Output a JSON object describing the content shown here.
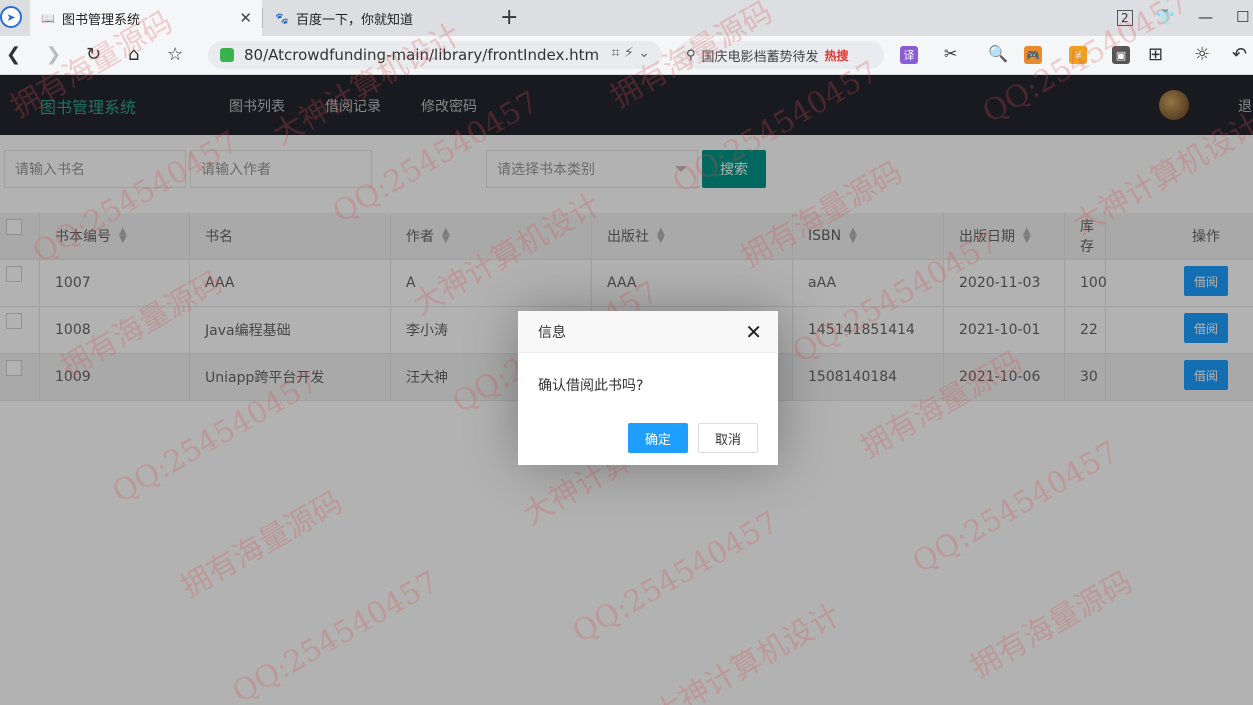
{
  "browser": {
    "tabs": [
      {
        "title": "图书管理系统"
      },
      {
        "title": "百度一下，你就知道"
      }
    ],
    "address": "80/Atcrowdfunding-main/library/frontIndex.htm",
    "search_text": "国庆电影档蓄势待发",
    "search_hot": "热搜",
    "tab_count": "2"
  },
  "app": {
    "logo": "图书管理系统",
    "nav": [
      "图书列表",
      "借阅记录",
      "修改密码"
    ],
    "logout": "退"
  },
  "filters": {
    "book_name_placeholder": "请输入书名",
    "author_placeholder": "请输入作者",
    "category_placeholder": "请选择书本类别",
    "search_button": "搜索"
  },
  "table": {
    "headers": [
      "书本编号",
      "书名",
      "作者",
      "出版社",
      "ISBN",
      "出版日期",
      "库存",
      "操作"
    ],
    "rows": [
      {
        "id": "1007",
        "name": "AAA",
        "author": "A",
        "publisher": "AAA",
        "isbn": "aAA",
        "date": "2020-11-03",
        "stock": "100",
        "action": "借阅"
      },
      {
        "id": "1008",
        "name": "Java编程基础",
        "author": "李小涛",
        "publisher": "",
        "isbn": "145141851414",
        "date": "2021-10-01",
        "stock": "22",
        "action": "借阅"
      },
      {
        "id": "1009",
        "name": "Uniapp跨平台开发",
        "author": "汪大神",
        "publisher": "",
        "isbn": "1508140184",
        "date": "2021-10-06",
        "stock": "30",
        "action": "借阅"
      }
    ]
  },
  "dialog": {
    "title": "信息",
    "message": "确认借阅此书吗?",
    "ok": "确定",
    "cancel": "取消"
  },
  "watermark": {
    "qq": "QQ:254540457",
    "slogan1": "拥有海量源码",
    "slogan2": "大神计算机设计"
  },
  "colors": {
    "header_bg": "#23262e",
    "logo": "#2fa38e",
    "search_btn": "#009688",
    "primary_btn": "#1e9fff"
  }
}
